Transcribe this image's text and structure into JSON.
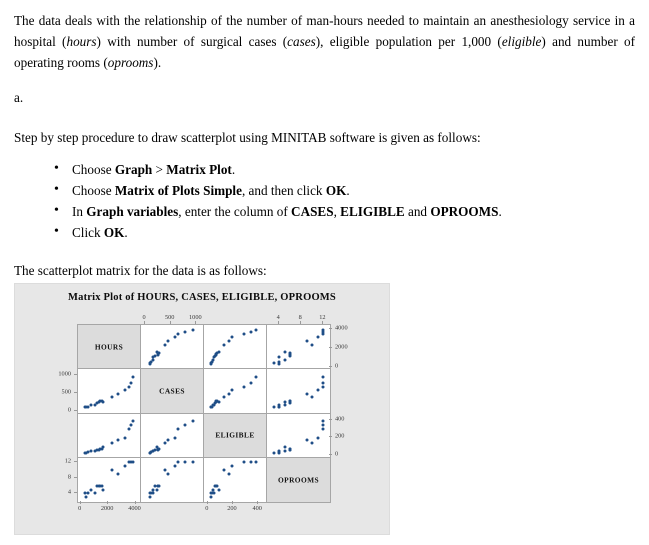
{
  "document": {
    "paragraph_1": "The data deals with the relationship of the number of man-hours needed to maintain an anesthesiology service in a hospital (hours) with number of surgical cases (cases), eligible population per 1,000 (eligible) and number of operating rooms (oprooms).",
    "part_label": "a.",
    "intro_line": "Step by step procedure to draw scatterplot using MINITAB software is given as follows:",
    "steps": [
      "Choose Graph > Matrix Plot.",
      "Choose Matrix of Plots Simple, and then click OK.",
      "In Graph variables, enter the column of CASES, ELIGIBLE and OPROOMS.",
      "Click OK."
    ],
    "closing_line": "The scatterplot matrix for the data is as follows:"
  },
  "chart_data": {
    "type": "scatter",
    "title": "Matrix Plot of HOURS, CASES, ELIGIBLE, OPROOMS",
    "variables": [
      "HOURS",
      "CASES",
      "ELIGIBLE",
      "OPROOMS"
    ],
    "grid": true,
    "legend": "none",
    "axes": {
      "HOURS": {
        "ticks": [
          0,
          2000,
          4000
        ],
        "range": [
          -200,
          4400
        ],
        "tick_labels": [
          "0",
          "2000",
          "4000"
        ]
      },
      "CASES": {
        "ticks": [
          0,
          500,
          1000
        ],
        "range": [
          -80,
          1150
        ],
        "tick_labels": [
          "0",
          "500",
          "1000"
        ]
      },
      "ELIGIBLE": {
        "ticks": [
          0,
          200,
          400
        ],
        "range": [
          -30,
          470
        ],
        "tick_labels": [
          "0",
          "200",
          "400"
        ]
      },
      "OPROOMS": {
        "ticks": [
          4,
          8,
          12
        ],
        "range": [
          1.8,
          13.2
        ],
        "tick_labels": [
          "4",
          "8",
          "12"
        ]
      }
    },
    "observations": [
      {
        "HOURS": 304,
        "CASES": 89,
        "ELIGIBLE": 25.5,
        "OPROOMS": 4
      },
      {
        "HOURS": 398,
        "CASES": 96,
        "ELIGIBLE": 28.0,
        "OPROOMS": 3
      },
      {
        "HOURS": 530,
        "CASES": 110,
        "ELIGIBLE": 30.0,
        "OPROOMS": 4
      },
      {
        "HOURS": 780,
        "CASES": 146,
        "ELIGIBLE": 43.5,
        "OPROOMS": 5
      },
      {
        "HOURS": 1030,
        "CASES": 160,
        "ELIGIBLE": 48.0,
        "OPROOMS": 4
      },
      {
        "HOURS": 1180,
        "CASES": 200,
        "ELIGIBLE": 58.0,
        "OPROOMS": 6
      },
      {
        "HOURS": 1300,
        "CASES": 248,
        "ELIGIBLE": 62.0,
        "OPROOMS": 6
      },
      {
        "HOURS": 1400,
        "CASES": 255,
        "ELIGIBLE": 68.0,
        "OPROOMS": 6
      },
      {
        "HOURS": 1520,
        "CASES": 262,
        "ELIGIBLE": 72.0,
        "OPROOMS": 6
      },
      {
        "HOURS": 1620,
        "CASES": 230,
        "ELIGIBLE": 90.0,
        "OPROOMS": 5
      },
      {
        "HOURS": 2300,
        "CASES": 380,
        "ELIGIBLE": 132.0,
        "OPROOMS": 10
      },
      {
        "HOURS": 2700,
        "CASES": 450,
        "ELIGIBLE": 168.0,
        "OPROOMS": 9
      },
      {
        "HOURS": 3200,
        "CASES": 580,
        "ELIGIBLE": 196.0,
        "OPROOMS": 11
      },
      {
        "HOURS": 3500,
        "CASES": 650,
        "ELIGIBLE": 290.0,
        "OPROOMS": 12
      },
      {
        "HOURS": 3700,
        "CASES": 780,
        "ELIGIBLE": 340.0,
        "OPROOMS": 12
      },
      {
        "HOURS": 3850,
        "CASES": 940,
        "ELIGIBLE": 385.0,
        "OPROOMS": 12
      }
    ]
  },
  "colors": {
    "marker": "#1f4e87",
    "chart_background": "#e7e7e7",
    "panel_background": "#ffffff",
    "diagonal_background": "#dcdcdc",
    "panel_border": "#a6a6a6"
  }
}
